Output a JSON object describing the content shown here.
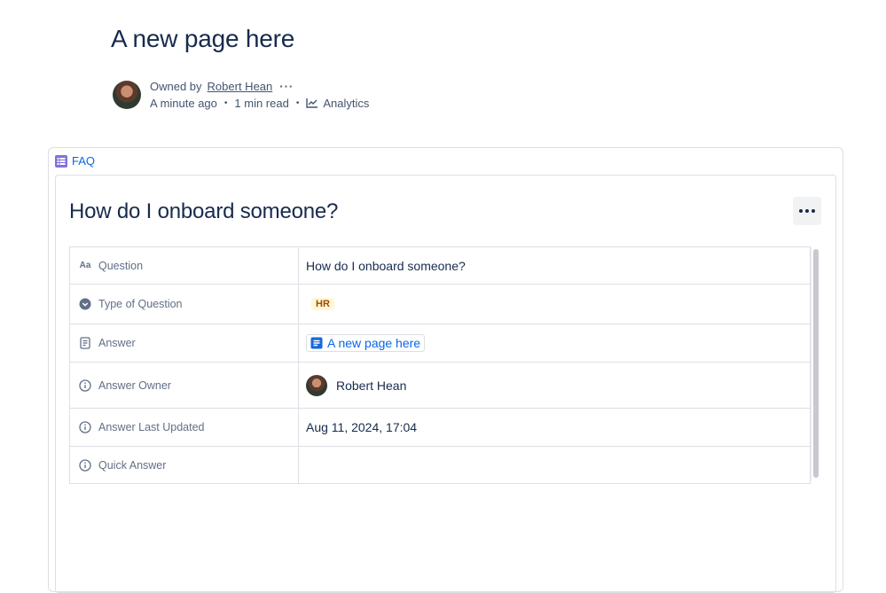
{
  "page": {
    "title": "A new page here"
  },
  "byline": {
    "owned_by_label": "Owned by",
    "owner_name": "Robert Hean",
    "time_ago": "A minute ago",
    "read_time": "1 min read",
    "analytics_label": "Analytics"
  },
  "database": {
    "name": "FAQ",
    "entry_title": "How do I onboard someone?",
    "fields": [
      {
        "label": "Question",
        "icon": "text-aa-icon",
        "value": "How do I onboard someone?"
      },
      {
        "label": "Type of Question",
        "icon": "status-check-icon",
        "tag": "HR"
      },
      {
        "label": "Answer",
        "icon": "page-icon",
        "link": "A new page here"
      },
      {
        "label": "Answer Owner",
        "icon": "info-icon",
        "person": "Robert Hean"
      },
      {
        "label": "Answer Last Updated",
        "icon": "info-icon",
        "value": "Aug 11, 2024, 17:04"
      },
      {
        "label": "Quick Answer",
        "icon": "info-icon",
        "value": ""
      }
    ]
  },
  "colors": {
    "link": "#0c66e4",
    "tag_text": "#a54800",
    "tag_bg": "#fff7d6",
    "db_icon": "#8270db"
  }
}
